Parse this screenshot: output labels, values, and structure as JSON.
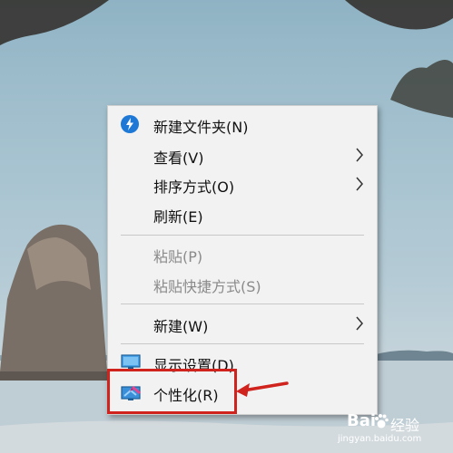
{
  "background": {
    "description_colors": [
      "#8fb3c4",
      "#d5dde1"
    ],
    "rock_color": "#7a6f66",
    "icon": "desktop-wallpaper"
  },
  "context_menu": {
    "items": [
      {
        "label": "新建文件夹(N)",
        "icon": "shield-lightning-icon",
        "enabled": true,
        "submenu": false
      },
      {
        "label": "查看(V)",
        "icon": "",
        "enabled": true,
        "submenu": true
      },
      {
        "label": "排序方式(O)",
        "icon": "",
        "enabled": true,
        "submenu": true
      },
      {
        "label": "刷新(E)",
        "icon": "",
        "enabled": true,
        "submenu": false
      },
      {
        "label": "粘贴(P)",
        "icon": "",
        "enabled": false,
        "submenu": false
      },
      {
        "label": "粘贴快捷方式(S)",
        "icon": "",
        "enabled": false,
        "submenu": false
      },
      {
        "label": "新建(W)",
        "icon": "",
        "enabled": true,
        "submenu": true
      },
      {
        "label": "显示设置(D)",
        "icon": "monitor-icon",
        "enabled": true,
        "submenu": false
      },
      {
        "label": "个性化(R)",
        "icon": "personalize-icon",
        "enabled": true,
        "submenu": false
      }
    ]
  },
  "annotation": {
    "highlight_color": "#d0231e",
    "arrow_icon": "red-arrow-icon"
  },
  "watermark": {
    "brand": "Bai",
    "name": "经验",
    "url": "jingyan.baidu.com"
  }
}
